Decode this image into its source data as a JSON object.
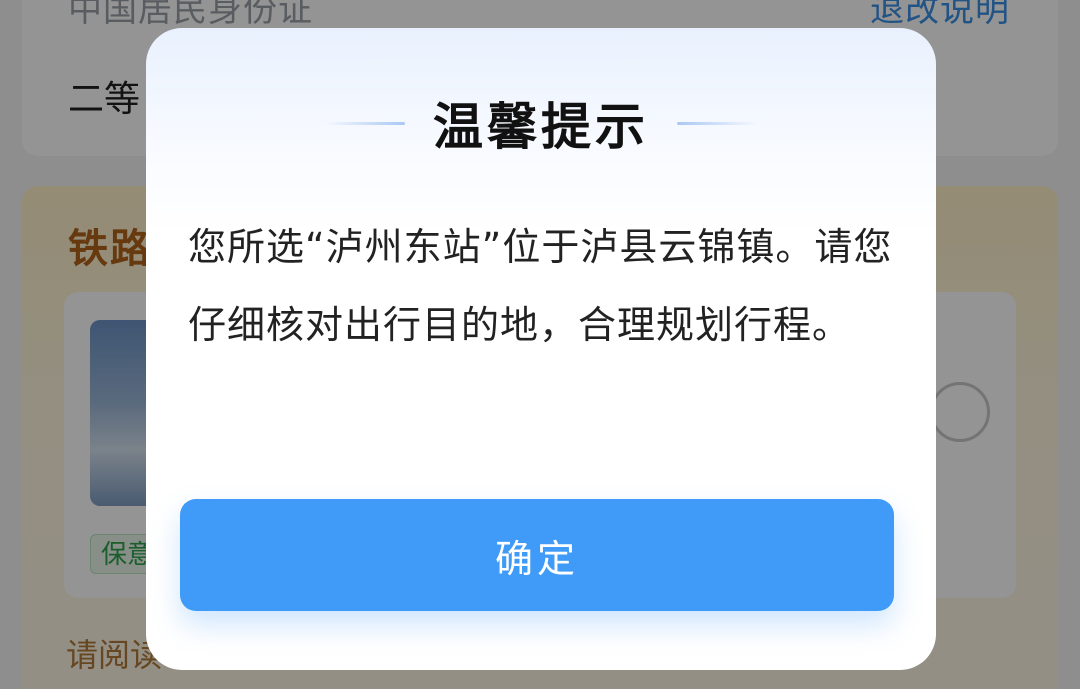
{
  "background": {
    "id_type": "中国居民身份证",
    "refund_link": "退改说明",
    "seat_class": "二等",
    "insurance_title": "铁路",
    "insurance_tag": "保意",
    "read_prompt": "请阅读"
  },
  "dialog": {
    "title": "温馨提示",
    "message": "您所选“泸州东站”位于泸县云锦镇。请您仔细核对出行目的地，合理规划行程。",
    "confirm_label": "确定"
  },
  "colors": {
    "primary_button": "#3f9bf7",
    "link": "#3c8fe6",
    "insurance_title": "#b0631a"
  }
}
